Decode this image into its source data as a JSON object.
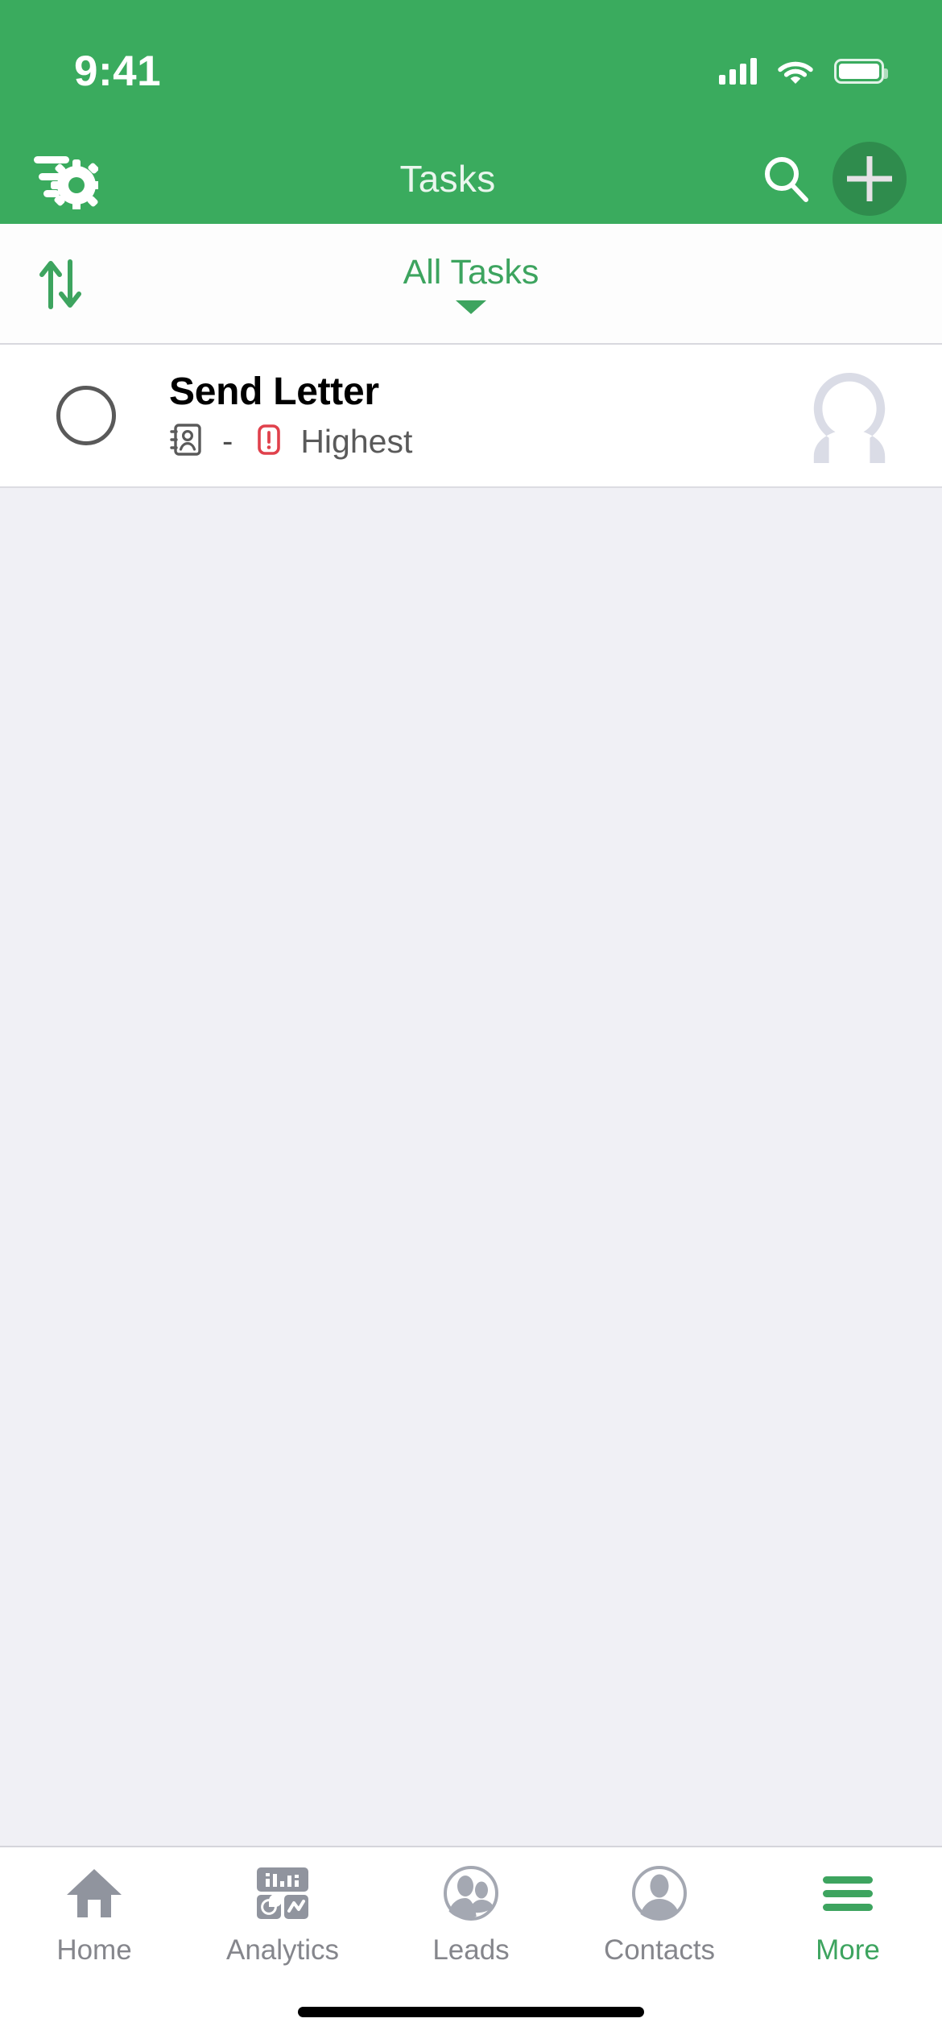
{
  "status_bar": {
    "time": "9:41",
    "cellular_icon": "signal-bars-icon",
    "wifi_icon": "wifi-icon",
    "battery_icon": "battery-icon"
  },
  "nav_bar": {
    "title": "Tasks",
    "filter_settings_icon": "filter-settings-icon",
    "search_icon": "search-icon",
    "add_icon": "plus-icon"
  },
  "filter_bar": {
    "sort_icon": "sort-arrows-icon",
    "scope_label": "All Tasks",
    "scope_caret_icon": "chevron-down-icon"
  },
  "tasks": [
    {
      "title": "Send Letter",
      "checkbox_state": "unchecked",
      "related_record_icon": "contact-card-icon",
      "related_record": "-",
      "priority_icon": "exclamation-priority-icon",
      "priority": "Highest",
      "avatar_icon": "user-avatar-placeholder"
    }
  ],
  "tab_bar": {
    "items": [
      {
        "label": "Home",
        "icon": "home-icon",
        "active": false
      },
      {
        "label": "Analytics",
        "icon": "analytics-icon",
        "active": false
      },
      {
        "label": "Leads",
        "icon": "leads-icon",
        "active": false
      },
      {
        "label": "Contacts",
        "icon": "contacts-icon",
        "active": false
      },
      {
        "label": "More",
        "icon": "hamburger-icon",
        "active": true
      }
    ]
  },
  "colors": {
    "brand_green": "#3AAB5E",
    "accent_green": "#3DA45F",
    "page_background": "#F0F0F5",
    "card_background": "#FFFFFF",
    "priority_red": "#E0414C",
    "muted_gray": "#85868C"
  }
}
